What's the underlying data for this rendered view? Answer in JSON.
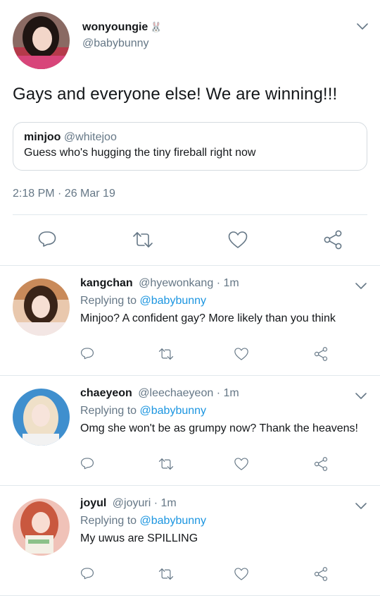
{
  "main_tweet": {
    "author": "wonyoungie",
    "author_emoji": "🐰",
    "handle": "@babybunny",
    "text": "Gays and everyone else! We are winning!!!",
    "quote": {
      "author": "minjoo",
      "handle": "@whitejoo",
      "text": "Guess who's hugging the tiny fireball right now"
    },
    "timestamp": "2:18 PM · 26 Mar 19"
  },
  "replies": [
    {
      "author": "kangchan",
      "handle": "@hyewonkang",
      "time": "· 1m",
      "replying_prefix": "Replying to",
      "replying_to": "@babybunny",
      "text": "Minjoo? A confident gay? More likely than you think"
    },
    {
      "author": "chaeyeon",
      "handle": "@leechaeyeon",
      "time": "· 1m",
      "replying_prefix": "Replying to",
      "replying_to": "@babybunny",
      "text": "Omg she won't be as grumpy now? Thank the heavens!"
    },
    {
      "author": "joyul",
      "handle": "@joyuri",
      "time": "· 1m",
      "replying_prefix": "Replying to",
      "replying_to": "@babybunny",
      "text": "My uwus are SPILLING"
    }
  ],
  "icons": [
    "chevron-down-icon",
    "reply-icon",
    "retweet-icon",
    "like-icon",
    "share-icon"
  ],
  "colors": {
    "text": "#14171a",
    "muted": "#657786",
    "link": "#1b95e0",
    "divider": "#e1e8ed"
  }
}
